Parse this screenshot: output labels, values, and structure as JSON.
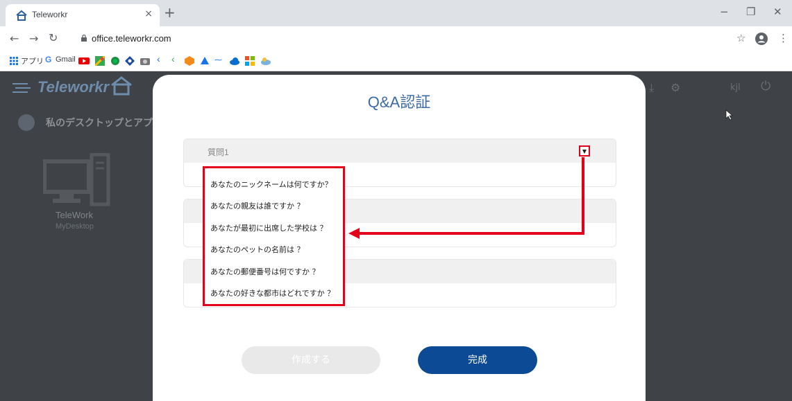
{
  "browser": {
    "tab_title": "Teleworkr",
    "tab_close": "×",
    "new_tab": "+",
    "url": "office.teleworkr.com",
    "window_controls": [
      "−",
      "❐",
      "✕"
    ],
    "bookmarks": {
      "apps_label": "アプリ",
      "gmail_label": "Gmail",
      "items": [
        "youtube-icon",
        "maps-icon",
        "app-icon-1",
        "app-icon-2",
        "app-icon-3",
        "app-icon-4",
        "app-icon-5",
        "office-icon",
        "drive-icon",
        "app-icon-6",
        "onedrive-icon",
        "microsoft-icon",
        "app-icon-7"
      ]
    }
  },
  "app": {
    "logo_text": "Teleworkr",
    "header_user": "kjl",
    "section_title": "私のデスクトップとアプ",
    "desktop_label": "TeleWork",
    "desktop_sub": "MyDesktop"
  },
  "modal": {
    "title": "Q&A認証",
    "question_label": "質問1",
    "dropdown_options": [
      "あなたのニックネームは何ですか？",
      "あなたの親友は誰ですか ？",
      "あなたが最初に出席した学校は ？",
      "あなたのペットの名前は ？",
      "あなたの郵便番号は何ですか ？",
      "あなたの好きな都市はどれですか ？"
    ],
    "create_button": "作成する",
    "done_button": "完成"
  },
  "colors": {
    "accent": "#0d4a95",
    "title": "#3d6ba5",
    "highlight": "#e3001b",
    "overlay": "#3f4347"
  }
}
